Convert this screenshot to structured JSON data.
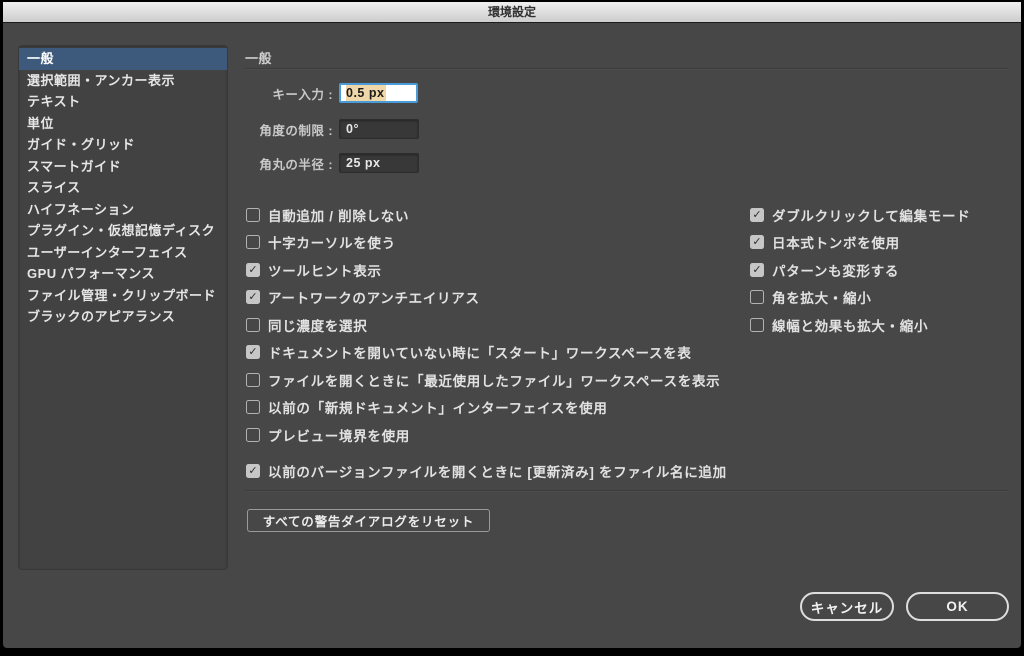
{
  "window": {
    "title": "環境設定"
  },
  "sidebar": {
    "items": [
      {
        "label": "一般",
        "selected": true
      },
      {
        "label": "選択範囲・アンカー表示",
        "selected": false
      },
      {
        "label": "テキスト",
        "selected": false
      },
      {
        "label": "単位",
        "selected": false
      },
      {
        "label": "ガイド・グリッド",
        "selected": false
      },
      {
        "label": "スマートガイド",
        "selected": false
      },
      {
        "label": "スライス",
        "selected": false
      },
      {
        "label": "ハイフネーション",
        "selected": false
      },
      {
        "label": "プラグイン・仮想記憶ディスク",
        "selected": false
      },
      {
        "label": "ユーザーインターフェイス",
        "selected": false
      },
      {
        "label": "GPU パフォーマンス",
        "selected": false
      },
      {
        "label": "ファイル管理・クリップボード",
        "selected": false
      },
      {
        "label": "ブラックのアピアランス",
        "selected": false
      }
    ]
  },
  "general": {
    "heading": "一般",
    "fields": [
      {
        "label": "キー入力 :",
        "value": "0.5 px",
        "focused": true
      },
      {
        "label": "角度の制限 :",
        "value": "0°",
        "focused": false
      },
      {
        "label": "角丸の半径 :",
        "value": "25 px",
        "focused": false
      }
    ],
    "checkboxes_left": [
      {
        "label": "自動追加 / 削除しない",
        "checked": false
      },
      {
        "label": "十字カーソルを使う",
        "checked": false
      },
      {
        "label": "ツールヒント表示",
        "checked": true
      },
      {
        "label": "アートワークのアンチエイリアス",
        "checked": true
      },
      {
        "label": "同じ濃度を選択",
        "checked": false
      },
      {
        "label": "ドキュメントを開いていない時に「スタート」ワークスペースを表",
        "checked": true
      },
      {
        "label": "ファイルを開くときに「最近使用したファイル」ワークスペースを表示",
        "checked": false
      },
      {
        "label": "以前の「新規ドキュメント」インターフェイスを使用",
        "checked": false
      },
      {
        "label": "プレビュー境界を使用",
        "checked": false
      },
      {
        "label": "以前のバージョンファイルを開くときに [更新済み] をファイル名に追加",
        "checked": true
      }
    ],
    "checkboxes_right": [
      {
        "label": "ダブルクリックして編集モード",
        "checked": true
      },
      {
        "label": "日本式トンボを使用",
        "checked": true
      },
      {
        "label": "パターンも変形する",
        "checked": true
      },
      {
        "label": "角を拡大・縮小",
        "checked": false
      },
      {
        "label": "線幅と効果も拡大・縮小",
        "checked": false
      }
    ],
    "reset_button": "すべての警告ダイアログをリセット"
  },
  "footer": {
    "cancel_label": "キャンセル",
    "ok_label": "OK"
  },
  "icons": {
    "checkmark": "✓"
  },
  "colors": {
    "selection_blue": "#3d5a7d",
    "focus_ring": "#4a9bd8",
    "text_selection": "#f0d7a9",
    "checkbox_checked": "#c6c6c6"
  }
}
